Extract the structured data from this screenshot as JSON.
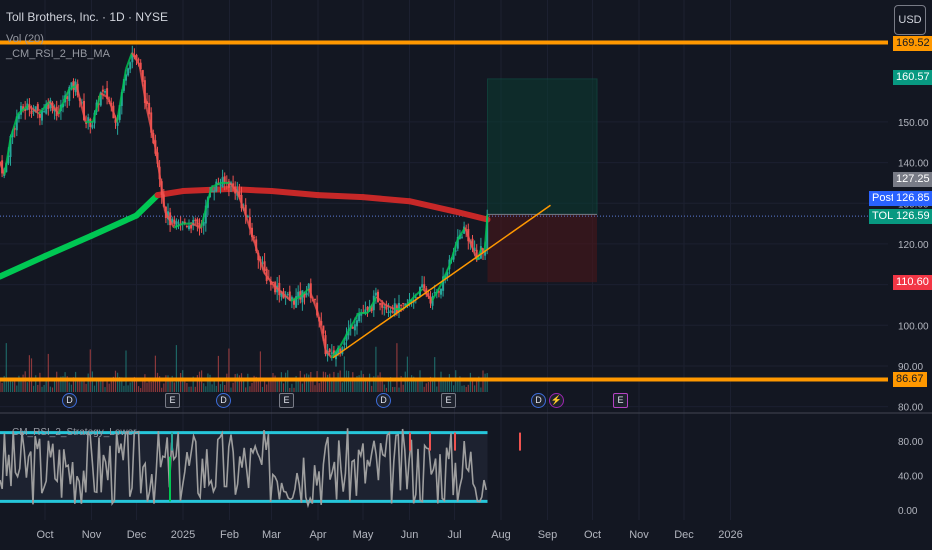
{
  "header": {
    "title": "Toll Brothers, Inc. · 1D · NYSE",
    "indicator_1": "Vol (20)",
    "indicator_2": "_CM_RSI_2_HB_MA",
    "indicator_3": "CM_RSI_2_Strategy_Lower"
  },
  "currency_button": "USD",
  "price_labels": {
    "resistance": "169.52",
    "target": "160.57",
    "last_close": "127.25",
    "post_tag": "Post",
    "post": "126.85",
    "ticker_tag": "TOL",
    "ticker": "126.59",
    "stop": "110.60",
    "support": "86.67"
  },
  "events": [
    {
      "kind": "dividend",
      "label": "D"
    },
    {
      "kind": "earnings",
      "label": "E"
    },
    {
      "kind": "dividend",
      "label": "D"
    },
    {
      "kind": "earnings",
      "label": "E"
    },
    {
      "kind": "dividend",
      "label": "D"
    },
    {
      "kind": "earnings",
      "label": "E"
    },
    {
      "kind": "dividend",
      "label": "D"
    },
    {
      "kind": "flash",
      "label": "⚡"
    },
    {
      "kind": "earnings-upcoming",
      "label": "E"
    }
  ],
  "colors": {
    "background": "#131722",
    "up": "#26a69a",
    "down": "#ef5350",
    "orange": "#ff9800",
    "ma_up": "#00c853",
    "ma_down": "#c62828",
    "rsi_band": "#26c6da",
    "rsi_line": "#9e9e9e",
    "target_label": "#089981",
    "stop_label": "#f23645",
    "post_label": "#2962ff"
  },
  "chart_data": [
    {
      "type": "candlestick",
      "title": "Toll Brothers, Inc. · 1D · NYSE",
      "x_ticks": [
        "Oct",
        "Nov",
        "Dec",
        "2025",
        "Feb",
        "Mar",
        "Apr",
        "May",
        "Jun",
        "Jul",
        "Aug",
        "Sep",
        "Oct",
        "Nov",
        "Dec",
        "2026"
      ],
      "y_ticks": [
        80,
        90,
        100,
        110,
        120,
        130,
        140,
        150
      ],
      "ylim": [
        78,
        172
      ],
      "close_path": [
        {
          "t": "2024-09-01",
          "v": 140
        },
        {
          "t": "2024-09-04",
          "v": 137
        },
        {
          "t": "2024-09-08",
          "v": 146
        },
        {
          "t": "2024-09-13",
          "v": 152
        },
        {
          "t": "2024-09-20",
          "v": 154
        },
        {
          "t": "2024-09-27",
          "v": 152
        },
        {
          "t": "2024-10-04",
          "v": 155
        },
        {
          "t": "2024-10-10",
          "v": 152
        },
        {
          "t": "2024-10-17",
          "v": 158
        },
        {
          "t": "2024-10-22",
          "v": 159
        },
        {
          "t": "2024-10-28",
          "v": 150
        },
        {
          "t": "2024-11-02",
          "v": 150
        },
        {
          "t": "2024-11-07",
          "v": 157
        },
        {
          "t": "2024-11-12",
          "v": 156
        },
        {
          "t": "2024-11-18",
          "v": 150
        },
        {
          "t": "2024-11-24",
          "v": 163
        },
        {
          "t": "2024-11-28",
          "v": 167
        },
        {
          "t": "2024-12-03",
          "v": 164
        },
        {
          "t": "2024-12-08",
          "v": 153
        },
        {
          "t": "2024-12-14",
          "v": 143
        },
        {
          "t": "2024-12-20",
          "v": 128
        },
        {
          "t": "2024-12-26",
          "v": 124
        },
        {
          "t": "2025-01-01",
          "v": 125
        },
        {
          "t": "2025-01-07",
          "v": 125
        },
        {
          "t": "2025-01-13",
          "v": 124
        },
        {
          "t": "2025-01-20",
          "v": 134
        },
        {
          "t": "2025-01-26",
          "v": 135
        },
        {
          "t": "2025-02-01",
          "v": 135
        },
        {
          "t": "2025-02-06",
          "v": 133
        },
        {
          "t": "2025-02-11",
          "v": 128
        },
        {
          "t": "2025-02-18",
          "v": 120
        },
        {
          "t": "2025-02-24",
          "v": 113
        },
        {
          "t": "2025-03-02",
          "v": 110
        },
        {
          "t": "2025-03-08",
          "v": 108
        },
        {
          "t": "2025-03-14",
          "v": 106
        },
        {
          "t": "2025-03-20",
          "v": 107
        },
        {
          "t": "2025-03-26",
          "v": 109
        },
        {
          "t": "2025-04-01",
          "v": 103
        },
        {
          "t": "2025-04-06",
          "v": 94
        },
        {
          "t": "2025-04-10",
          "v": 92
        },
        {
          "t": "2025-04-16",
          "v": 95
        },
        {
          "t": "2025-04-22",
          "v": 99
        },
        {
          "t": "2025-04-28",
          "v": 103
        },
        {
          "t": "2025-05-04",
          "v": 103
        },
        {
          "t": "2025-05-10",
          "v": 107
        },
        {
          "t": "2025-05-16",
          "v": 105
        },
        {
          "t": "2025-05-22",
          "v": 104
        },
        {
          "t": "2025-05-28",
          "v": 104
        },
        {
          "t": "2025-06-04",
          "v": 107
        },
        {
          "t": "2025-06-10",
          "v": 109
        },
        {
          "t": "2025-06-16",
          "v": 106
        },
        {
          "t": "2025-06-22",
          "v": 110
        },
        {
          "t": "2025-06-28",
          "v": 115
        },
        {
          "t": "2025-07-03",
          "v": 121
        },
        {
          "t": "2025-07-08",
          "v": 124
        },
        {
          "t": "2025-07-12",
          "v": 120
        },
        {
          "t": "2025-07-16",
          "v": 116
        },
        {
          "t": "2025-07-19",
          "v": 119
        },
        {
          "t": "2025-07-21",
          "v": 118
        },
        {
          "t": "2025-07-23",
          "v": 127.25
        }
      ],
      "moving_average": [
        {
          "t": "2024-09-01",
          "v": 112
        },
        {
          "t": "2024-10-01",
          "v": 117
        },
        {
          "t": "2024-11-01",
          "v": 122
        },
        {
          "t": "2024-12-01",
          "v": 127
        },
        {
          "t": "2024-12-15",
          "v": 132
        },
        {
          "t": "2025-01-01",
          "v": 133
        },
        {
          "t": "2025-02-01",
          "v": 133.5
        },
        {
          "t": "2025-03-01",
          "v": 133
        },
        {
          "t": "2025-04-01",
          "v": 132
        },
        {
          "t": "2025-05-01",
          "v": 131.5
        },
        {
          "t": "2025-06-01",
          "v": 130.5
        },
        {
          "t": "2025-07-01",
          "v": 128
        },
        {
          "t": "2025-07-23",
          "v": 126
        }
      ],
      "horizontal_lines": [
        {
          "name": "resistance",
          "value": 169.52
        },
        {
          "name": "support",
          "value": 86.67
        },
        {
          "name": "post_market",
          "value": 126.85
        }
      ],
      "trendline": {
        "from": {
          "t": "2025-04-11",
          "v": 92
        },
        "to": {
          "t": "2025-09-03",
          "v": 129.5
        }
      },
      "position": {
        "start": "2025-07-23",
        "end": "2025-10-04",
        "entry": 127.25,
        "target": 160.57,
        "stop": 110.6
      }
    },
    {
      "type": "line",
      "title": "CM_RSI_2_Strategy_Lower",
      "y_ticks": [
        0,
        40,
        80
      ],
      "ylim": [
        0,
        100
      ],
      "bands": [
        10,
        90
      ]
    }
  ]
}
